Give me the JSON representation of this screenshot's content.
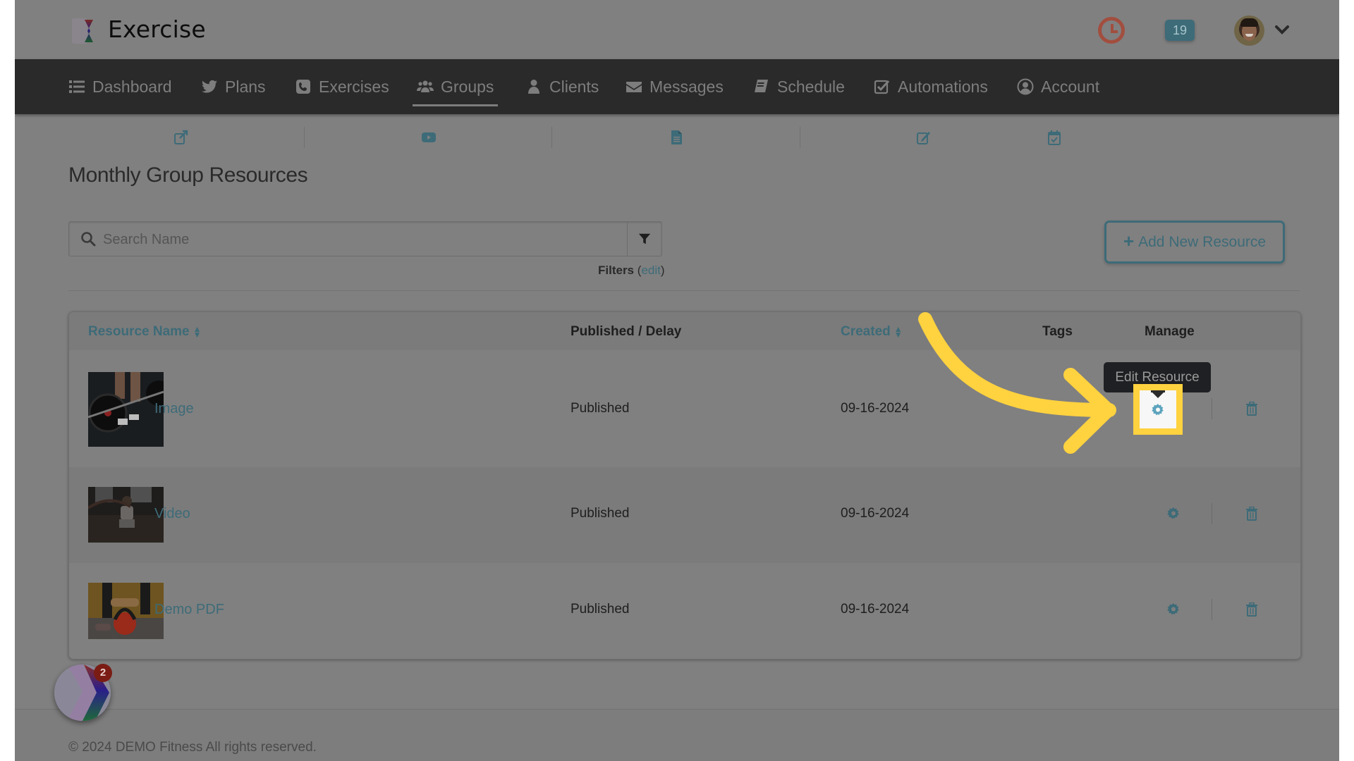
{
  "header": {
    "brand": "Exercise",
    "notification_count": "19",
    "icons": {
      "clock": "clock-icon",
      "avatar": "user-avatar",
      "chevron": "chevron-down-icon"
    }
  },
  "nav": {
    "items": [
      {
        "label": "Dashboard",
        "icon": "list-icon",
        "active": false
      },
      {
        "label": "Plans",
        "icon": "twitter-bird-icon",
        "active": false
      },
      {
        "label": "Exercises",
        "icon": "phone-square-icon",
        "active": false
      },
      {
        "label": "Groups",
        "icon": "users-icon",
        "active": true
      },
      {
        "label": "Clients",
        "icon": "user-icon",
        "active": false
      },
      {
        "label": "Messages",
        "icon": "envelope-icon",
        "active": false
      },
      {
        "label": "Schedule",
        "icon": "book-icon",
        "active": false
      },
      {
        "label": "Automations",
        "icon": "check-square-icon",
        "active": false
      },
      {
        "label": "Account",
        "icon": "user-circle-icon",
        "active": false
      }
    ]
  },
  "subnav": {
    "icons": [
      "external-link-icon",
      "video-play-icon",
      "file-text-icon",
      "edit-icon",
      "calendar-check-icon"
    ]
  },
  "page": {
    "title": "Monthly Group Resources",
    "search_placeholder": "Search Name",
    "search_value": "",
    "filters_label": "Filters",
    "filters_edit": "edit",
    "add_button": "Add New Resource",
    "add_button_icon": "+"
  },
  "table": {
    "columns": [
      {
        "label": "Resource Name",
        "sortable": true
      },
      {
        "label": "Published / Delay",
        "sortable": false
      },
      {
        "label": "Created",
        "sortable": true
      },
      {
        "label": "Tags",
        "sortable": false
      },
      {
        "label": "Manage",
        "sortable": false
      }
    ],
    "rows": [
      {
        "name": "Image",
        "status": "Published",
        "created": "09-16-2024",
        "tags": "",
        "thumb": "barbell-deadlift"
      },
      {
        "name": "Video",
        "status": "Published",
        "created": "09-16-2024",
        "tags": "",
        "thumb": "battle-ropes"
      },
      {
        "name": "Demo PDF",
        "status": "Published",
        "created": "09-16-2024",
        "tags": "",
        "thumb": "kettlebell"
      }
    ]
  },
  "tooltip": {
    "text": "Edit Resource"
  },
  "annotation": {
    "color": "#ffd23f",
    "type": "arrow-pointing-to-edit-gear"
  },
  "footer": {
    "text": "© 2024 DEMO Fitness All rights reserved."
  },
  "widget": {
    "badge": "2"
  },
  "colors": {
    "accent": "#3d6b78",
    "navbar": "#2a2a2a",
    "overlay_bg": "#808080",
    "highlight": "#ffd23f",
    "clock": "#a24e3f",
    "badge": "#7a1c14"
  }
}
